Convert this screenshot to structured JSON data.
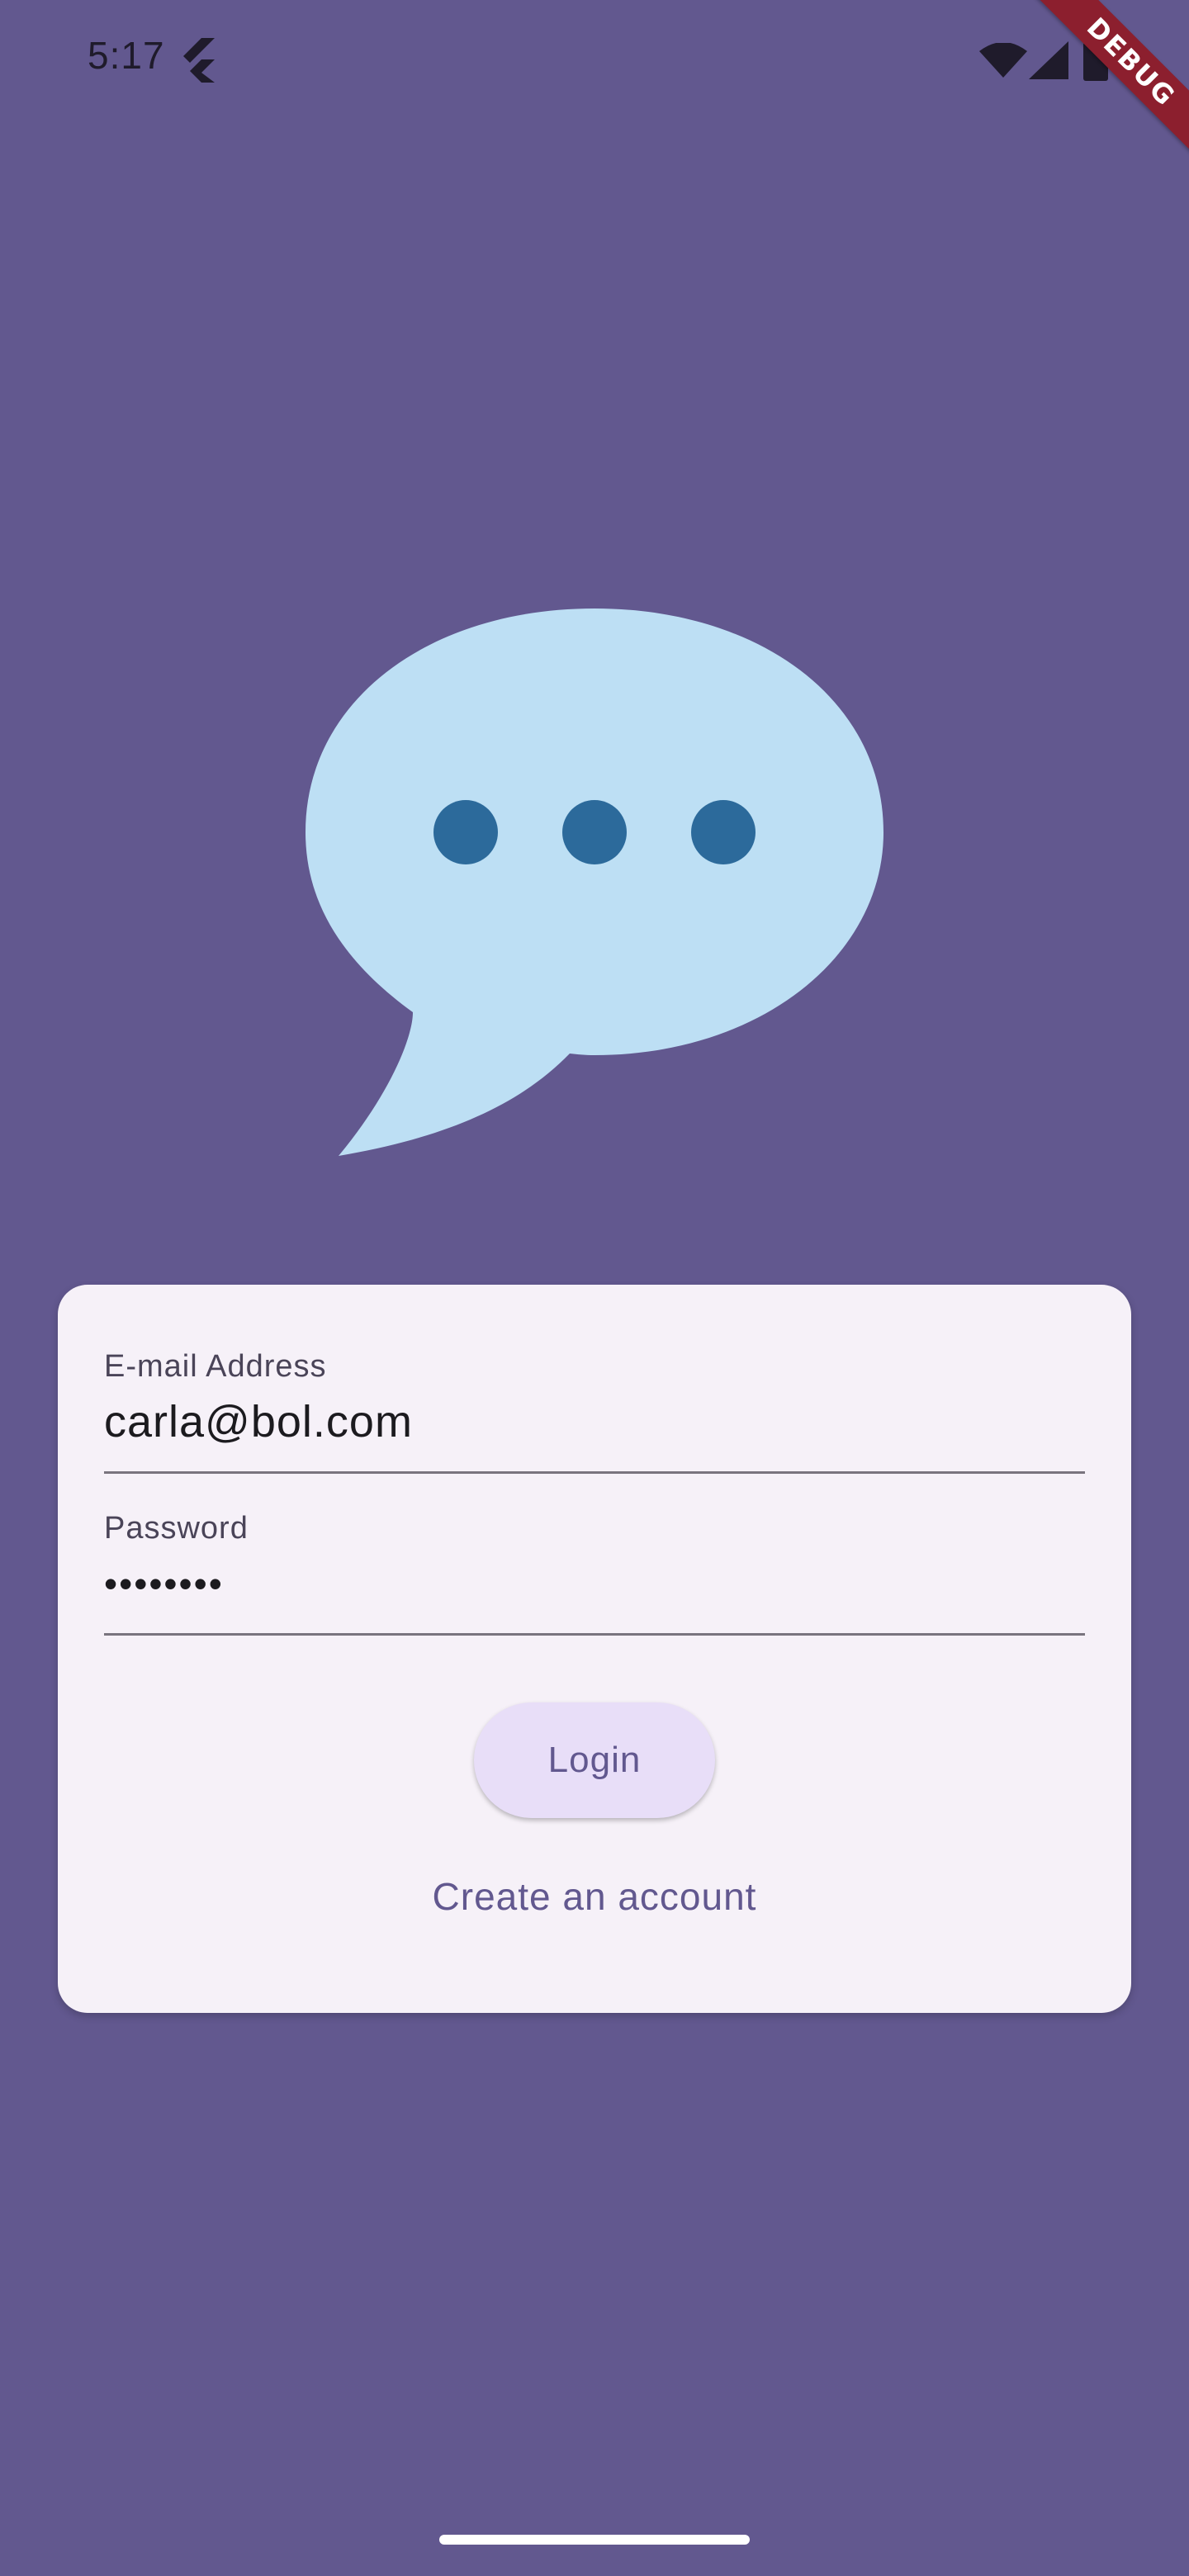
{
  "status_bar": {
    "time": "5:17",
    "debug_label": "DEBUG"
  },
  "icons": {
    "logo": "chat-bubble-icon",
    "flutter": "flutter-icon",
    "wifi": "wifi-icon",
    "signal": "cellular-signal-icon",
    "battery": "battery-icon"
  },
  "login_form": {
    "email_label": "E-mail Address",
    "email_value": "carla@bol.com",
    "password_label": "Password",
    "password_value": "••••••••",
    "login_button_label": "Login",
    "create_account_label": "Create an account"
  },
  "colors": {
    "background": "#62588f",
    "card": "#f6f1f8",
    "bubble": "#bddff4",
    "bubble_dots": "#2c6a9b",
    "button": "#e8def8",
    "accent": "#62588f",
    "debug_ribbon": "#8c1f2e"
  }
}
